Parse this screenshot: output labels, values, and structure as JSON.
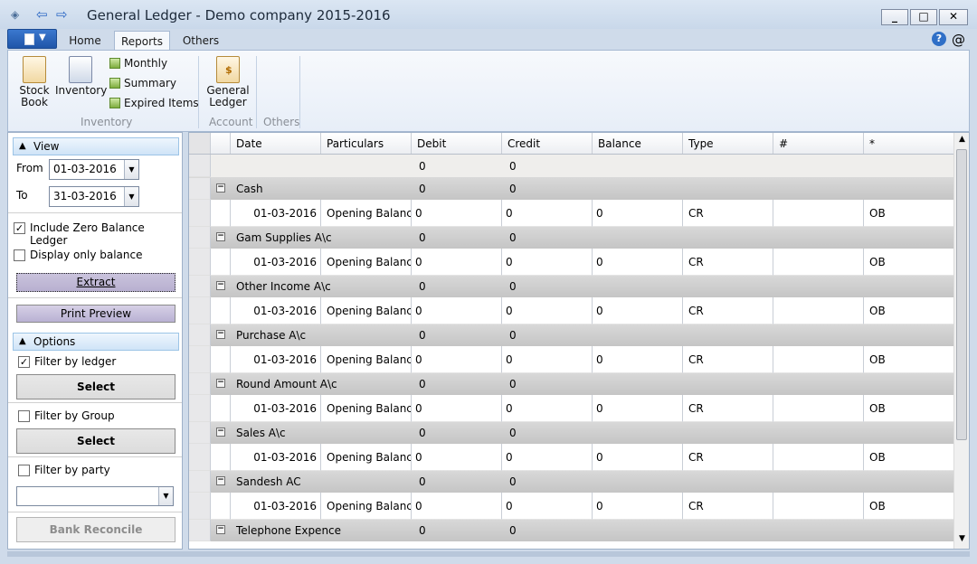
{
  "window": {
    "title": "General Ledger - Demo company 2015-2016",
    "minimize": "_",
    "maximize": "□",
    "close": "✕"
  },
  "tabs": [
    {
      "label": "Home"
    },
    {
      "label": "Reports"
    },
    {
      "label": "Others"
    }
  ],
  "ribbon": {
    "stock_book": "Stock Book",
    "inventory": "Inventory",
    "monthly": "Monthly",
    "summary": "Summary",
    "expired_items": "Expired Items",
    "group_inventory": "Inventory",
    "general_ledger": "General Ledger",
    "group_account": "Account",
    "group_others": "Others",
    "help": "?",
    "at": "@"
  },
  "left": {
    "view_header": "View",
    "from_label": "From",
    "from_value": "01-03-2016",
    "to_label": "To",
    "to_value": "31-03-2016",
    "include_zero": "Include Zero Balance Ledger",
    "include_zero_checked": true,
    "display_only_balance": "Display only balance",
    "display_only_balance_checked": false,
    "extract": "Extract",
    "print_preview": "Print Preview",
    "options_header": "Options",
    "filter_ledger": "Filter by ledger",
    "filter_ledger_checked": true,
    "select1": "Select",
    "filter_group": "Filter by Group",
    "filter_group_checked": false,
    "select2": "Select",
    "filter_party": "Filter by party",
    "filter_party_checked": false,
    "party_value": "",
    "bank_reconcile": "Bank Reconcile"
  },
  "grid": {
    "columns": [
      "Date",
      "Particulars",
      "Debit",
      "Credit",
      "Balance",
      "Type",
      "#",
      "*"
    ],
    "total": {
      "debit": "0",
      "credit": "0"
    },
    "groups": [
      {
        "name": "Cash",
        "debit": "0",
        "credit": "0",
        "row": {
          "date": "01-03-2016",
          "particulars": "Opening Balance",
          "debit": "0",
          "credit": "0",
          "balance": "0",
          "type": "CR",
          "hash": "",
          "star": "OB"
        }
      },
      {
        "name": "Gam Supplies A\\c",
        "debit": "0",
        "credit": "0",
        "row": {
          "date": "01-03-2016",
          "particulars": "Opening Balance",
          "debit": "0",
          "credit": "0",
          "balance": "0",
          "type": "CR",
          "hash": "",
          "star": "OB"
        }
      },
      {
        "name": "Other Income A\\c",
        "debit": "0",
        "credit": "0",
        "row": {
          "date": "01-03-2016",
          "particulars": "Opening Balance",
          "debit": "0",
          "credit": "0",
          "balance": "0",
          "type": "CR",
          "hash": "",
          "star": "OB"
        }
      },
      {
        "name": "Purchase A\\c",
        "debit": "0",
        "credit": "0",
        "row": {
          "date": "01-03-2016",
          "particulars": "Opening Balance",
          "debit": "0",
          "credit": "0",
          "balance": "0",
          "type": "CR",
          "hash": "",
          "star": "OB"
        }
      },
      {
        "name": "Round Amount A\\c",
        "debit": "0",
        "credit": "0",
        "row": {
          "date": "01-03-2016",
          "particulars": "Opening Balance",
          "debit": "0",
          "credit": "0",
          "balance": "0",
          "type": "CR",
          "hash": "",
          "star": "OB"
        }
      },
      {
        "name": "Sales A\\c",
        "debit": "0",
        "credit": "0",
        "row": {
          "date": "01-03-2016",
          "particulars": "Opening Balance",
          "debit": "0",
          "credit": "0",
          "balance": "0",
          "type": "CR",
          "hash": "",
          "star": "OB"
        }
      },
      {
        "name": "Sandesh AC",
        "debit": "0",
        "credit": "0",
        "row": {
          "date": "01-03-2016",
          "particulars": "Opening Balance",
          "debit": "0",
          "credit": "0",
          "balance": "0",
          "type": "CR",
          "hash": "",
          "star": "OB"
        }
      },
      {
        "name": "Telephone Expence",
        "debit": "0",
        "credit": "0",
        "row": null
      }
    ]
  }
}
